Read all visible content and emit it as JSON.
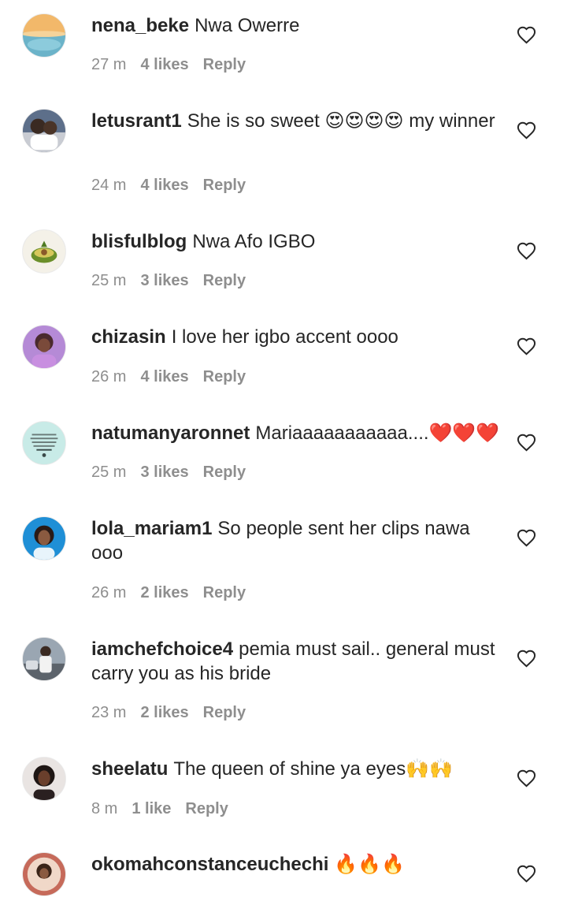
{
  "comments": [
    {
      "username": "nena_beke",
      "text": "Nwa Owerre",
      "time": "27 m",
      "likes": "4 likes",
      "reply": "Reply"
    },
    {
      "username": "letusrant1",
      "text": "She is so sweet 😍😍😍😍 my winner",
      "time": "24 m",
      "likes": "4 likes",
      "reply": "Reply"
    },
    {
      "username": "blisfulblog",
      "text": "Nwa Afo IGBO",
      "time": "25 m",
      "likes": "3 likes",
      "reply": "Reply"
    },
    {
      "username": "chizasin",
      "text": "I love her igbo accent oooo",
      "time": "26 m",
      "likes": "4 likes",
      "reply": "Reply"
    },
    {
      "username": "natumanyaronnet",
      "text": "Mariaaaaaaaaaaa....❤️❤️❤️",
      "time": "25 m",
      "likes": "3 likes",
      "reply": "Reply"
    },
    {
      "username": "lola_mariam1",
      "text": "So people sent her clips nawa ooo",
      "time": "26 m",
      "likes": "2 likes",
      "reply": "Reply"
    },
    {
      "username": "iamchefchoice4",
      "text": "pemia must sail.. general must carry you as his bride",
      "time": "23 m",
      "likes": "2 likes",
      "reply": "Reply"
    },
    {
      "username": "sheelatu",
      "text": "The queen of shine ya eyes🙌🙌",
      "time": "8 m",
      "likes": "1 like",
      "reply": "Reply"
    },
    {
      "username": "okomahconstanceuchechi",
      "text": "🔥🔥🔥",
      "time": "",
      "likes": "",
      "reply": ""
    }
  ],
  "colors": {
    "text": "#262626",
    "meta": "#8e8e8e",
    "background": "#ffffff"
  },
  "icons": {
    "like": "heart-outline-icon"
  }
}
